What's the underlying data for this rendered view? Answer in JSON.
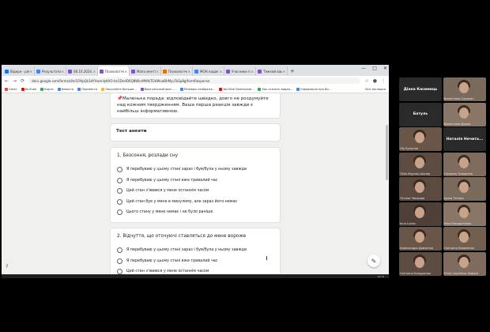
{
  "browser": {
    "tabs": [
      {
        "label": "Відкри - роботи",
        "color": "#1a73e8",
        "active": false
      },
      {
        "label": "Результати пош",
        "color": "#4285f4",
        "active": false
      },
      {
        "label": "08.10.2024. Пе",
        "color": "#7e57c2",
        "active": false
      },
      {
        "label": "Психологічне",
        "color": "#7e57c2",
        "active": true
      },
      {
        "label": "Мапа ментально",
        "color": "#7e57c2",
        "active": false
      },
      {
        "label": "Психологічна",
        "color": "#e37400",
        "active": false
      },
      {
        "label": "МОН надає",
        "color": "#4285f4",
        "active": false
      },
      {
        "label": "Учасники путь",
        "color": "#7e57c2",
        "active": false
      },
      {
        "label": "Тяжкий ваш",
        "color": "#7e57c2",
        "active": false
      }
    ],
    "new_tab": "+",
    "window_controls": [
      "—",
      "□",
      "✕"
    ],
    "url": "docs.google.com/forms/d/e/1FAIpQLSdYVwnnIyKhO-bn1DndO6Q8WknMt9kTGHWvaBhMyuTuSp8g/formResponse",
    "nav_icons": [
      "←",
      "→",
      "⟳"
    ],
    "bookmarks": [
      {
        "label": "Gmail",
        "color": "#ea4335"
      },
      {
        "label": "YouTube",
        "color": "#ff0000"
      },
      {
        "label": "Карти",
        "color": "#34a853"
      },
      {
        "label": "Новости",
        "color": "#4285f4"
      },
      {
        "label": "Перевести",
        "color": "#4285f4"
      },
      {
        "label": "Покупайте больше...",
        "color": "#fbbc05"
      },
      {
        "label": "Виртуальный фон -...",
        "color": "#7e57c2"
      },
      {
        "label": "Размеры изображе...",
        "color": "#4285f4"
      },
      {
        "label": "YouTube Downloade...",
        "color": "#ff0000"
      },
      {
        "label": "Как скачать видео...",
        "color": "#34a853"
      },
      {
        "label": "Інформація про Ви...",
        "color": "#4285f4"
      }
    ],
    "bookmarks_right": "Все закладки"
  },
  "form": {
    "tip": "📌Маленька порада: відповідайте швидко, довго не роздумуйте над кожним твердженням. Ваша перша реакція завжди є найбільш інформативною.",
    "section_title": "Тест анкети",
    "q1": {
      "title": "1. Безсоння, розлади сну",
      "options": [
        "Я перебуваю у цьому стані зараз і був/була у ньому завжди",
        "Я перебуваю у цьому стані вже тривалий час",
        "Цей стан з'явився у мене останнім часом",
        "Цей стан був у мене в минулому, але зараз його немає",
        "Цього стану у мене немає і не було раніше"
      ]
    },
    "q2": {
      "title": "2. Відчуття, що оточуючі ставляться до мене вороже",
      "options": [
        "Я перебуваю у цьому стані зараз і був/була у ньому завжди",
        "Я перебуваю у цьому стані вже тривалий час",
        "Цей стан з'явився у мене останнім часом"
      ]
    },
    "fab_icon": "✎",
    "help_icon": "?"
  },
  "taskbar": {
    "time": "14:15"
  },
  "participants": [
    {
      "label": "Діана Касимець",
      "kind": "name"
    },
    {
      "label": "Валентина Сорокан",
      "kind": "video"
    },
    {
      "label": "Батуль",
      "kind": "name"
    },
    {
      "label": "Валентина Дикая",
      "kind": "video"
    },
    {
      "label": "Ліл Кулупна",
      "kind": "video"
    },
    {
      "label": "Наталія Нечитайло",
      "kind": "name"
    },
    {
      "label": "Лілія Мурзак-Шопер",
      "kind": "video"
    },
    {
      "label": "Оксанна Трещенко",
      "kind": "video"
    },
    {
      "label": "Тетяна Чемісова",
      "kind": "video"
    },
    {
      "label": "Ірина  Тетяна",
      "kind": "video"
    },
    {
      "label": "Inna Lunko",
      "kind": "video"
    },
    {
      "label": "Nina Кондратенко",
      "kind": "video"
    },
    {
      "label": "Александра Дивченко",
      "kind": "video"
    },
    {
      "label": "Світлана Коваленко",
      "kind": "video"
    },
    {
      "label": "Світлана Кондратюк",
      "kind": "video"
    },
    {
      "label": "Юлія Сергіївна Лаврен",
      "kind": "video"
    }
  ],
  "participant_names_big": {
    "p0": "Діана Касимець",
    "p2": "Батуль",
    "p5": "Наталія Нечита..."
  }
}
